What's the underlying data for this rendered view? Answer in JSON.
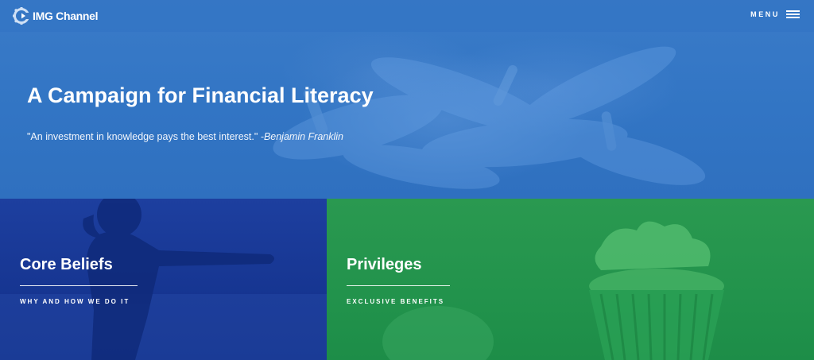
{
  "header": {
    "brand": "IMG Channel",
    "menu_label": "MENU"
  },
  "hero": {
    "title": "A Campaign for Financial Literacy",
    "quote_text": "\"An investment in knowledge pays the best interest.\"",
    "quote_author": "-Benjamin Franklin"
  },
  "panels": [
    {
      "title": "Core Beliefs",
      "subtitle": "WHY AND HOW WE DO IT"
    },
    {
      "title": "Privileges",
      "subtitle": "EXCLUSIVE BENEFITS"
    }
  ],
  "colors": {
    "hero_blue": "#3275c4",
    "panel_blue": "#163591",
    "panel_green": "#22934c"
  },
  "icons": [
    "logo-gear-icon",
    "hamburger-menu-icon"
  ]
}
